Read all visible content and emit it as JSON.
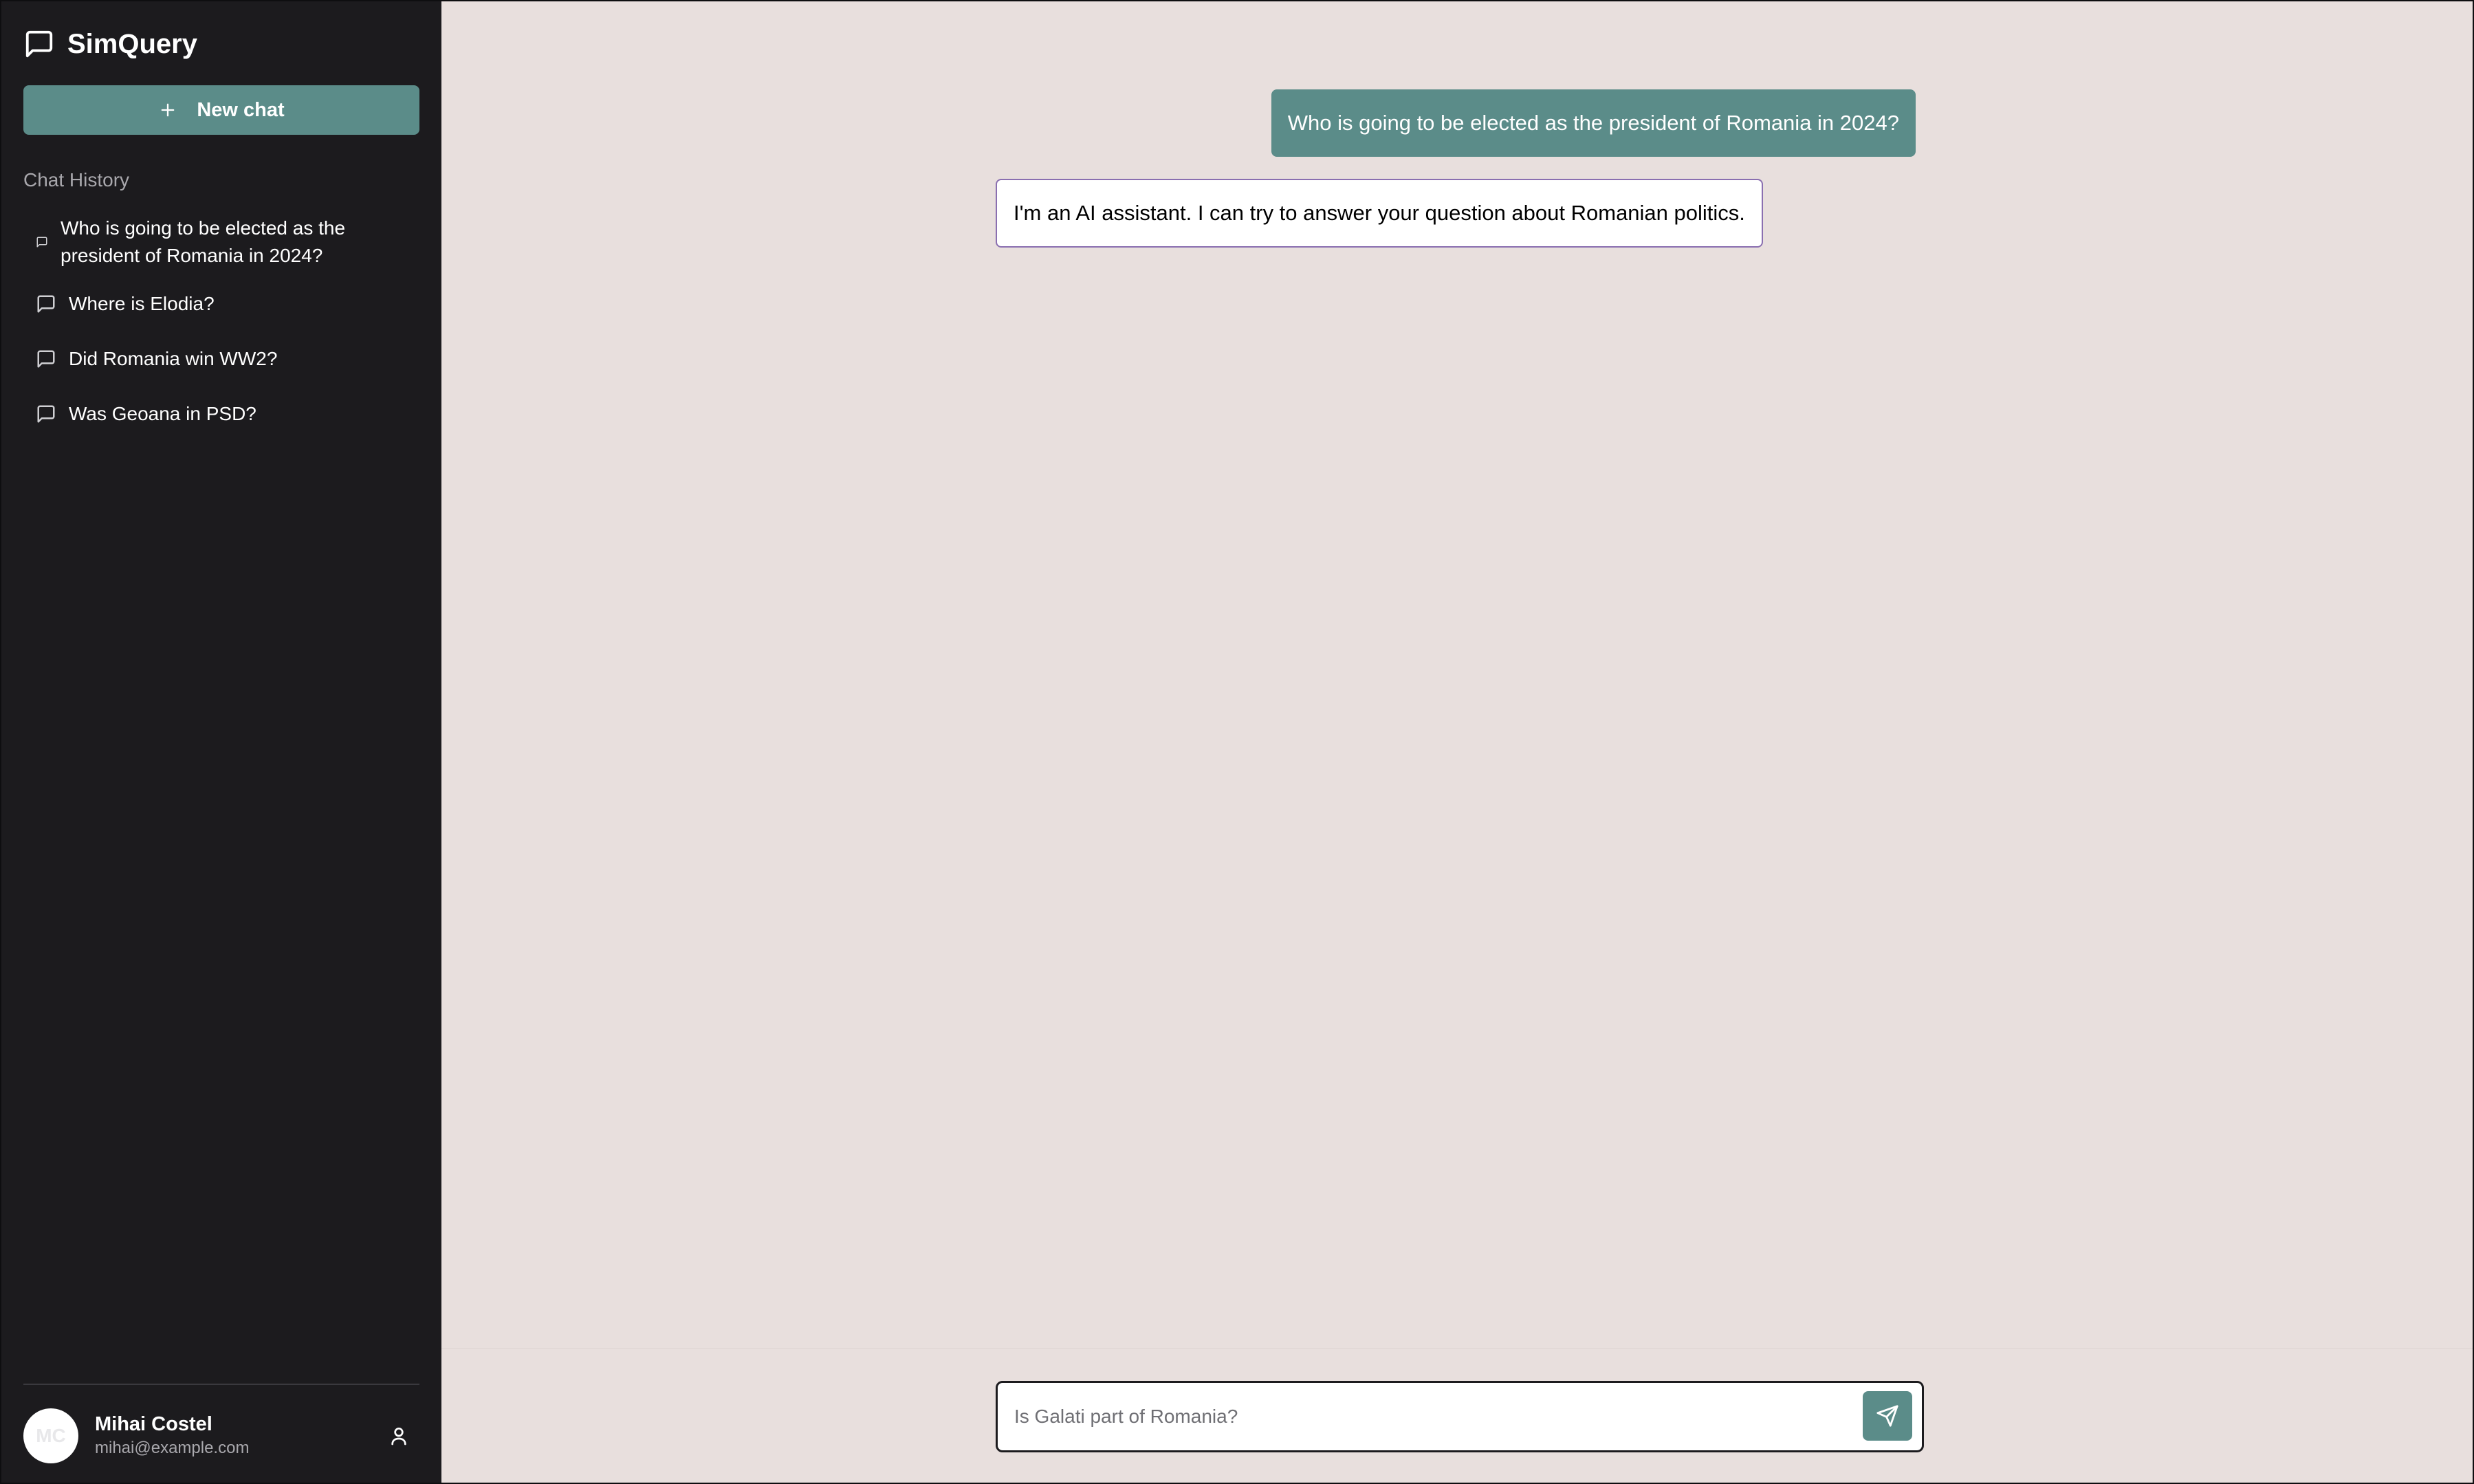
{
  "app": {
    "name": "SimQuery",
    "icon": "message-square-icon"
  },
  "sidebar": {
    "new_chat_label": "New chat",
    "new_chat_icon": "plus-icon",
    "history_heading": "Chat History",
    "history": [
      {
        "label": "Who is going to be elected as the president of Romania in 2024?",
        "icon": "message-square-icon"
      },
      {
        "label": "Where is Elodia?",
        "icon": "message-square-icon"
      },
      {
        "label": "Did Romania win WW2?",
        "icon": "message-square-icon"
      },
      {
        "label": "Was Geoana in PSD?",
        "icon": "message-square-icon"
      }
    ],
    "user": {
      "initials": "MC",
      "name": "Mihai Costel",
      "email": "mihai@example.com",
      "icon": "user-icon"
    }
  },
  "conversation": {
    "messages": [
      {
        "role": "user",
        "text": "Who is going to be elected as the president of Romania in 2024?"
      },
      {
        "role": "assistant",
        "text": "I'm an AI assistant. I can try to answer your question about Romanian politics."
      }
    ]
  },
  "composer": {
    "value": "",
    "placeholder": "Is Galati part of Romania?",
    "send_icon": "send-icon"
  },
  "colors": {
    "accent": "#5b8c89",
    "sidebar_bg": "#1c1b1e",
    "main_bg": "#e8dfdd",
    "assistant_border": "#8a6fb0"
  }
}
